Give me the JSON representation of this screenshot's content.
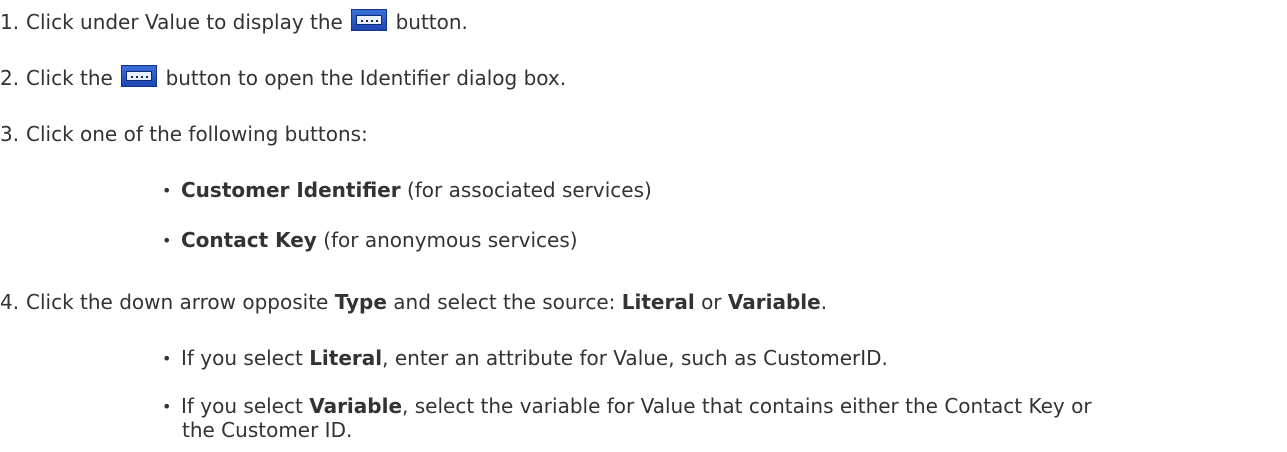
{
  "steps": [
    {
      "number": "1.",
      "before": "Click under Value to display the",
      "after": "button."
    },
    {
      "number": "2.",
      "before": "Click the",
      "after": "button to open the Identifier dialog box."
    },
    {
      "number": "3.",
      "text": "Click one of the following buttons:"
    },
    {
      "number": "4.",
      "before": "Click the down arrow opposite",
      "bold1": "Type",
      "middle": "and select the source:",
      "bold2": "Literal",
      "or": "or",
      "bold3": "Variable",
      "end": "."
    }
  ],
  "step3_options": [
    {
      "bold": "Customer Identifier",
      "rest": "(for associated services)"
    },
    {
      "bold": "Contact Key",
      "rest": "(for anonymous services)"
    }
  ],
  "step4_options": [
    {
      "prefix": "If you select",
      "bold": "Literal",
      "rest": ", enter an attribute for Value, such as CustomerID."
    },
    {
      "prefix": "If you select",
      "bold": "Variable",
      "rest": ", select the variable for Value that contains either the Contact Key or",
      "continuation": "the Customer ID."
    }
  ],
  "icons": {
    "ellipsis_button": "ellipsis-button-icon",
    "bullet": "•"
  }
}
